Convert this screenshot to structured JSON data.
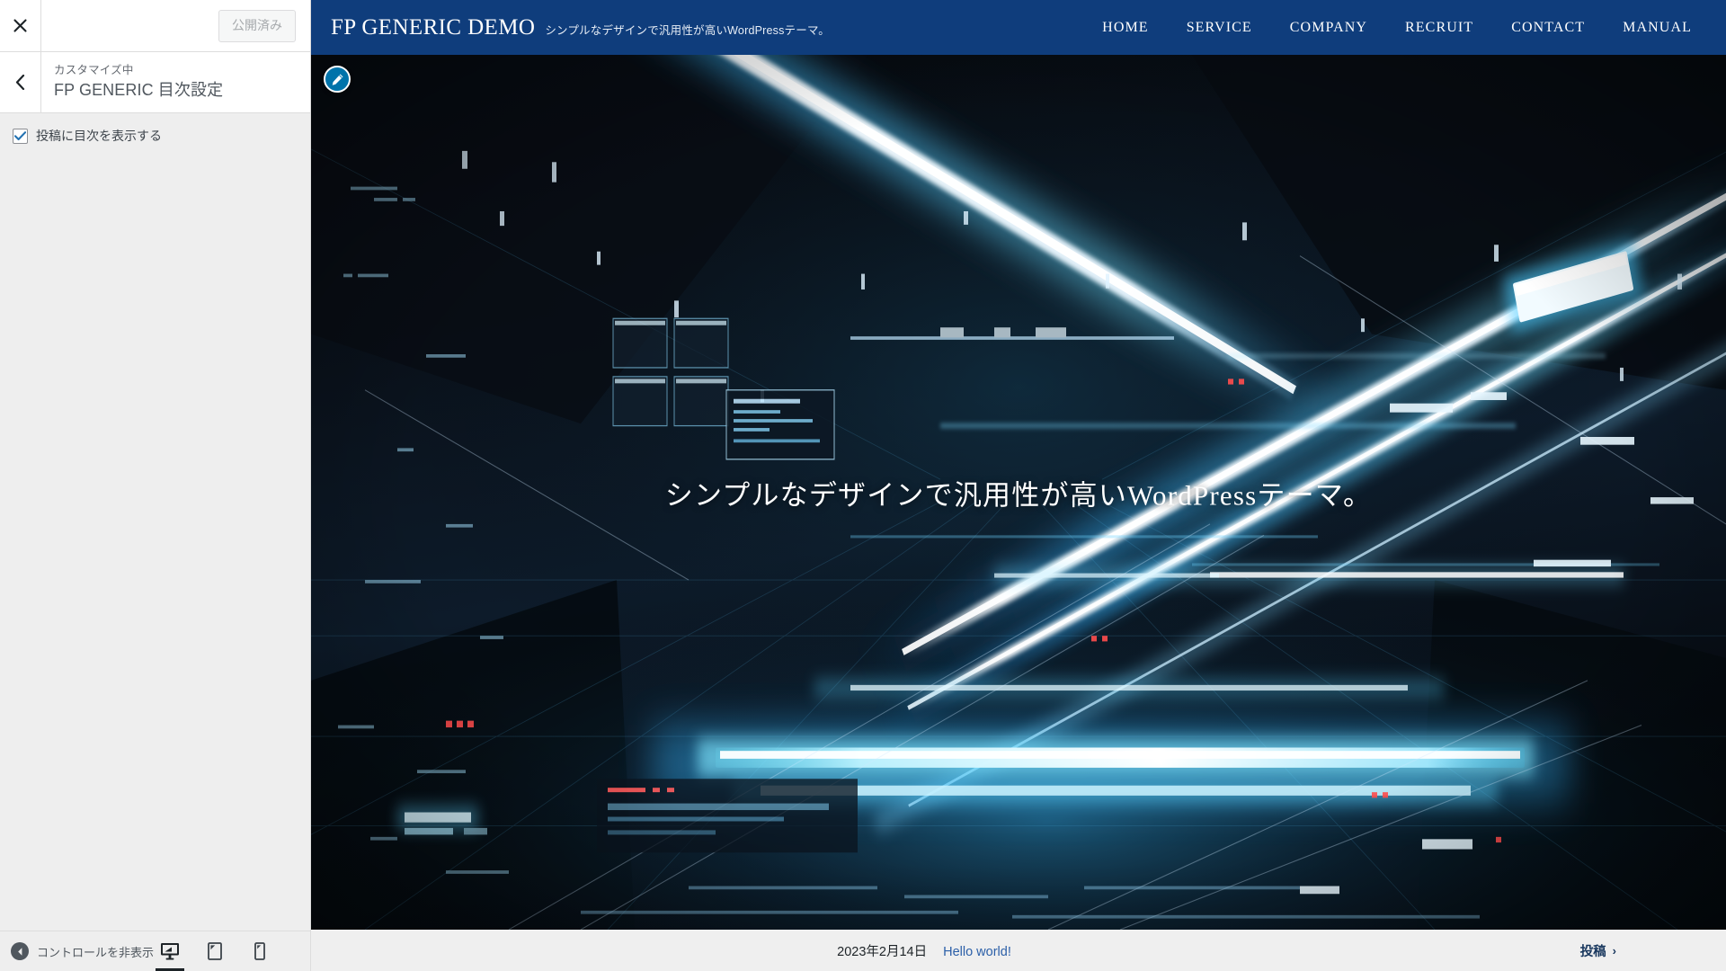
{
  "customizer": {
    "close_label": "×",
    "close_icon": "close-icon",
    "publish_button": "公開済み",
    "publish_state": "published-disabled",
    "back_icon": "chevron-left-icon",
    "eyebrow": "カスタマイズ中",
    "panel_title": "FP GENERIC 目次設定",
    "controls": [
      {
        "type": "checkbox",
        "label": "投稿に目次を表示する",
        "checked": true
      }
    ],
    "footer": {
      "collapse_label": "コントロールを非表示",
      "collapse_icon": "chevron-left-circle-icon",
      "devices": [
        {
          "name": "desktop",
          "icon": "desktop-icon",
          "active": true
        },
        {
          "name": "tablet",
          "icon": "tablet-icon",
          "active": false
        },
        {
          "name": "mobile",
          "icon": "mobile-icon",
          "active": false
        }
      ]
    },
    "accent_color": "#0073aa",
    "panel_bg": "#eeeeee"
  },
  "preview": {
    "edit_shortcut_icon": "pencil-icon",
    "site": {
      "title": "FP GENERIC DEMO",
      "tagline": "シンプルなデザインで汎用性が高いWordPressテーマ。",
      "header_color": "#0f3d7c",
      "nav": [
        {
          "label": "HOME"
        },
        {
          "label": "SERVICE"
        },
        {
          "label": "COMPANY"
        },
        {
          "label": "RECRUIT"
        },
        {
          "label": "CONTACT"
        },
        {
          "label": "MANUAL"
        }
      ]
    },
    "hero": {
      "caption": "シンプルなデザインで汎用性が高いWordPressテーマ。",
      "image_description": "futuristic dark blue data-center corridor with glowing cyan light streaks",
      "base_color": "#05080d",
      "glow_color": "#3fc8ff"
    },
    "footer": {
      "post_date": "2023年2月14日",
      "post_title": "Hello world!",
      "post_link_color": "#2b5fa8",
      "next_nav_label": "投稿",
      "next_nav_chevron": "›"
    }
  }
}
